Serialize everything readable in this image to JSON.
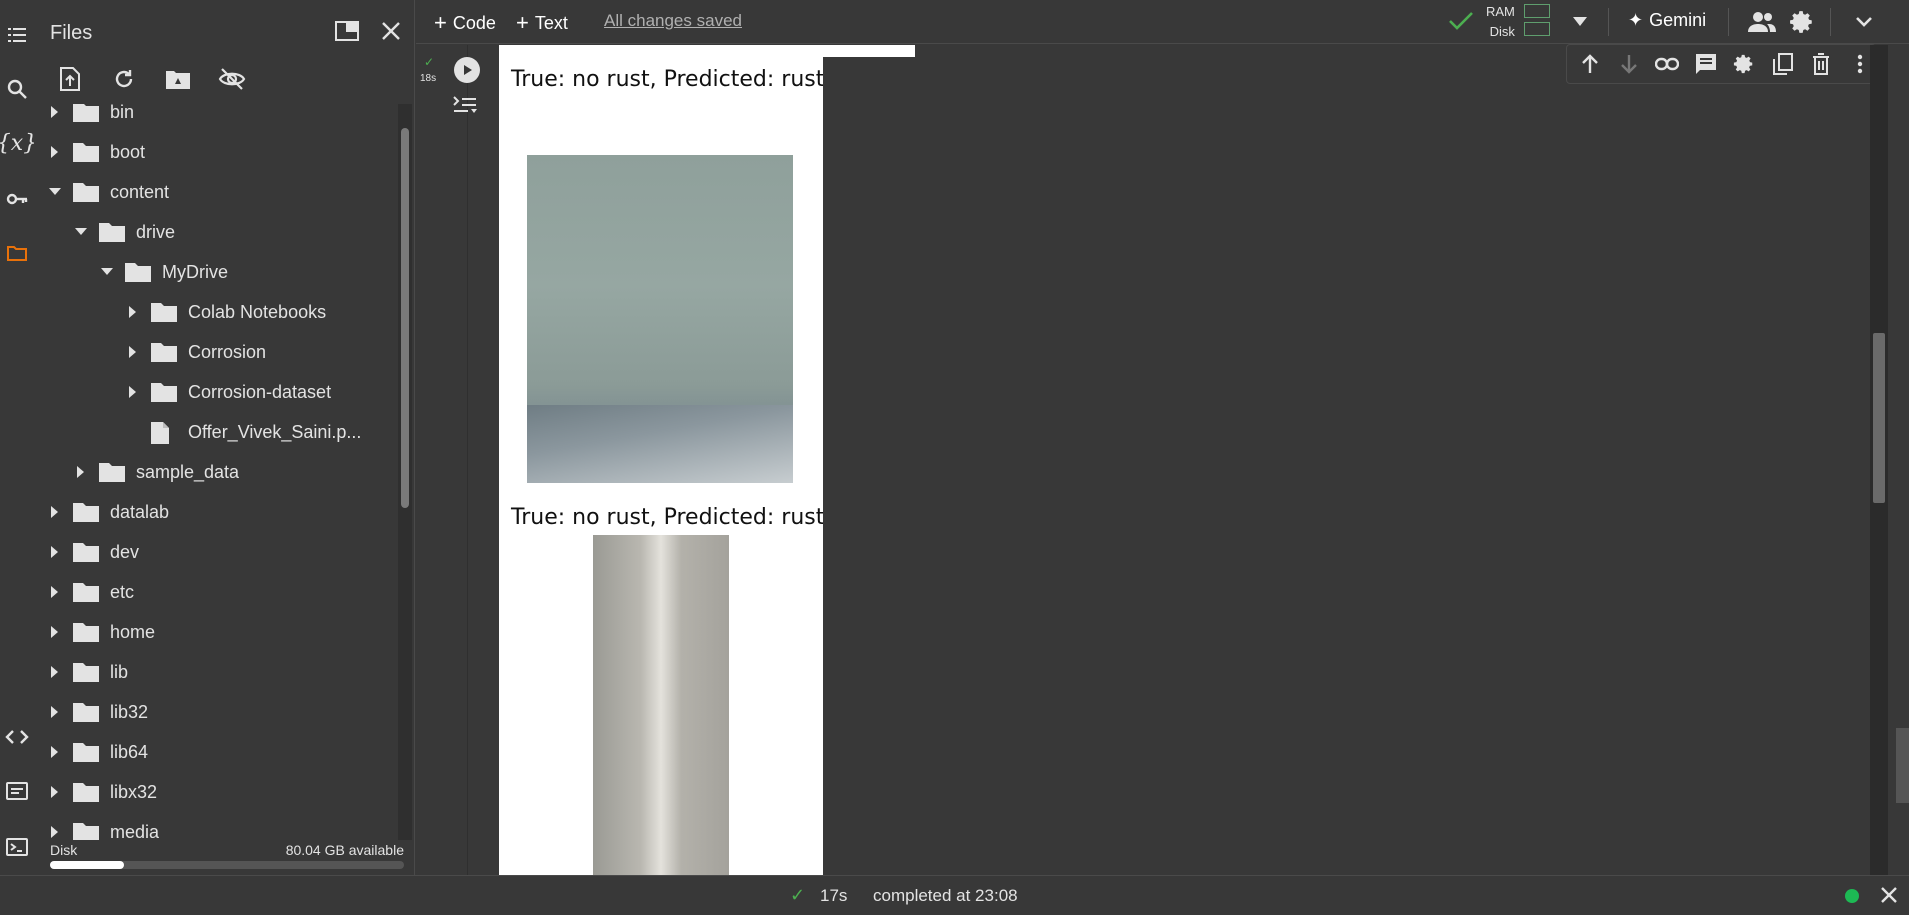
{
  "files_panel": {
    "title": "Files",
    "toolbar": [
      "upload-icon",
      "refresh-icon",
      "drive-folder-icon",
      "hide-icon"
    ],
    "tree": [
      {
        "label": "bin",
        "depth": 0,
        "type": "folder",
        "state": "collapsed"
      },
      {
        "label": "boot",
        "depth": 0,
        "type": "folder",
        "state": "collapsed"
      },
      {
        "label": "content",
        "depth": 0,
        "type": "folder",
        "state": "expanded"
      },
      {
        "label": "drive",
        "depth": 1,
        "type": "folder",
        "state": "expanded"
      },
      {
        "label": "MyDrive",
        "depth": 2,
        "type": "folder",
        "state": "expanded"
      },
      {
        "label": "Colab Notebooks",
        "depth": 3,
        "type": "folder",
        "state": "collapsed"
      },
      {
        "label": "Corrosion",
        "depth": 3,
        "type": "folder",
        "state": "collapsed"
      },
      {
        "label": "Corrosion-dataset",
        "depth": 3,
        "type": "folder",
        "state": "collapsed"
      },
      {
        "label": "Offer_Vivek_Saini.p...",
        "depth": 3,
        "type": "file",
        "state": "none"
      },
      {
        "label": "sample_data",
        "depth": 1,
        "type": "folder",
        "state": "collapsed"
      },
      {
        "label": "datalab",
        "depth": 0,
        "type": "folder",
        "state": "collapsed"
      },
      {
        "label": "dev",
        "depth": 0,
        "type": "folder",
        "state": "collapsed"
      },
      {
        "label": "etc",
        "depth": 0,
        "type": "folder",
        "state": "collapsed"
      },
      {
        "label": "home",
        "depth": 0,
        "type": "folder",
        "state": "collapsed"
      },
      {
        "label": "lib",
        "depth": 0,
        "type": "folder",
        "state": "collapsed"
      },
      {
        "label": "lib32",
        "depth": 0,
        "type": "folder",
        "state": "collapsed"
      },
      {
        "label": "lib64",
        "depth": 0,
        "type": "folder",
        "state": "collapsed"
      },
      {
        "label": "libx32",
        "depth": 0,
        "type": "folder",
        "state": "collapsed"
      },
      {
        "label": "media",
        "depth": 0,
        "type": "folder",
        "state": "collapsed"
      }
    ],
    "disk_label": "Disk",
    "disk_available": "80.04 GB available",
    "disk_used_fraction": 0.21
  },
  "topbar": {
    "code_label": "Code",
    "text_label": "Text",
    "saved_status": "All changes saved",
    "ram_label": "RAM",
    "disk_label": "Disk",
    "gemini_label": "Gemini"
  },
  "cell": {
    "exec_time": "18s",
    "outputs": [
      {
        "caption": "True: no rust, Predicted: rust"
      },
      {
        "caption": "True: no rust, Predicted: rust"
      }
    ]
  },
  "status_bar": {
    "duration": "17s",
    "completed": "completed at 23:08"
  },
  "colors": {
    "background": "#383838",
    "accent_orange": "#e8710a",
    "status_green": "#1db954",
    "check_green": "#4caf50"
  }
}
